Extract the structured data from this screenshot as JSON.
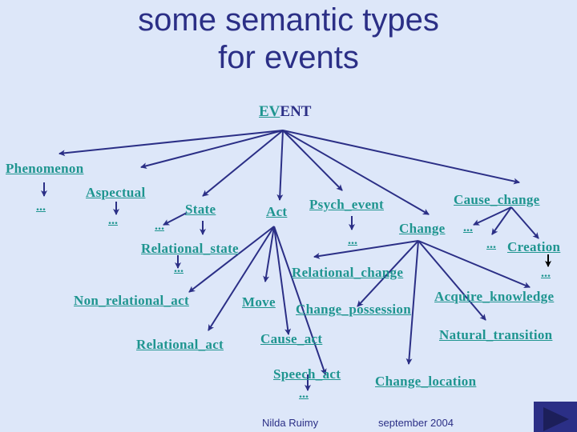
{
  "slide": {
    "title_line1": "some semantic types",
    "title_line2": "for events",
    "root": {
      "highlight": "EV",
      "rest": "ENT"
    },
    "nodes": {
      "phenomenon": "Phenomenon",
      "phenomenon_more": "...",
      "aspectual": "Aspectual",
      "aspectual_more": "...",
      "state": "State",
      "state_more": "...",
      "relational_state": "Relational_state",
      "relational_state_more": "...",
      "act": "Act",
      "non_relational_act": "Non_relational_act",
      "relational_act": "Relational_act",
      "move": "Move",
      "cause_act": "Cause_act",
      "speech_act": "Speech_act",
      "speech_act_more": "...",
      "psych_event": "Psych_event",
      "psych_event_more": "...",
      "change": "Change",
      "relational_change": "Relational_change",
      "change_possession": "Change_possession",
      "change_location": "Change_location",
      "natural_transition": "Natural_transition",
      "acquire_knowledge": "Acquire_knowledge",
      "cause_change": "Cause_change",
      "cause_change_more_1": "...",
      "cause_change_more_2": "...",
      "creation": "Creation",
      "creation_more": "..."
    },
    "footer": {
      "author": "Nilda Ruimy",
      "date": "september 2004"
    },
    "nav": {
      "next_icon": "play-triangle"
    },
    "colors": {
      "background": "#dde7f9",
      "title": "#2b2f86",
      "link": "#1f9590",
      "arrow": "#2b2f86"
    }
  }
}
